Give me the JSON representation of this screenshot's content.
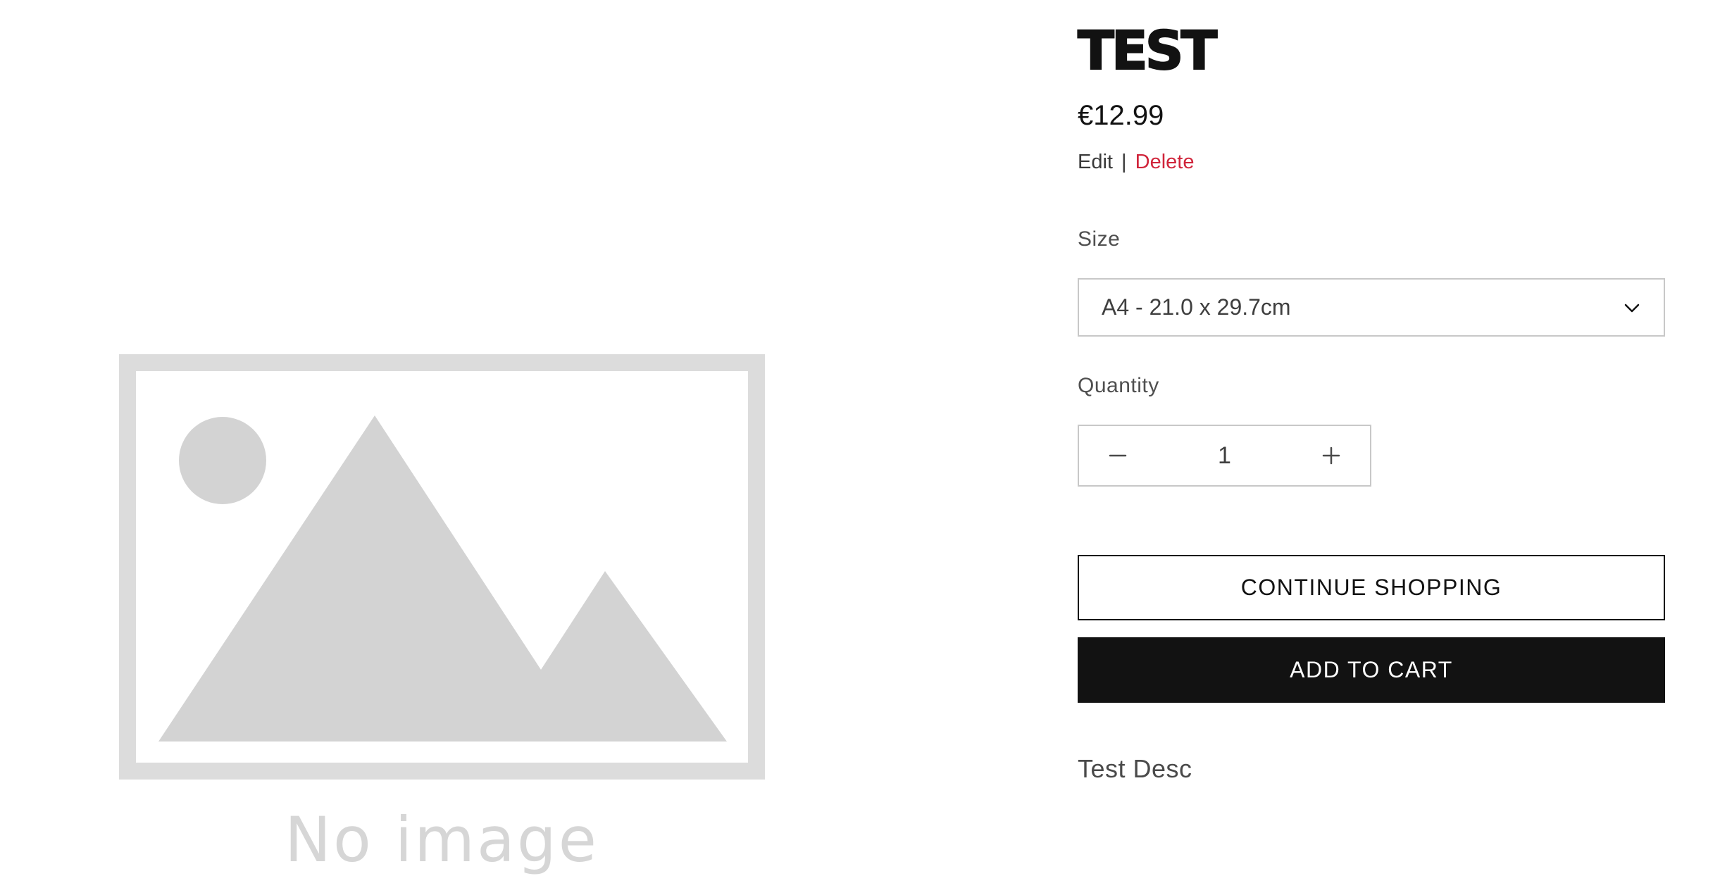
{
  "media": {
    "placeholder_icon": "image-placeholder-icon",
    "no_image_text": "No image"
  },
  "product": {
    "title": "TEST",
    "price": "€12.99",
    "admin": {
      "edit_label": "Edit",
      "separator": "|",
      "delete_label": "Delete"
    },
    "size": {
      "label": "Size",
      "selected": "A4 - 21.0 x 29.7cm",
      "icon": "chevron-down-icon"
    },
    "quantity": {
      "label": "Quantity",
      "value": "1",
      "decrease_icon": "minus-icon",
      "increase_icon": "plus-icon"
    },
    "buttons": {
      "continue_label": "CONTINUE SHOPPING",
      "add_to_cart_label": "ADD TO CART"
    },
    "description": "Test Desc"
  },
  "colors": {
    "text": "#121212",
    "delete": "#d0243a",
    "border": "#c8c8c8",
    "placeholder": "#d3d3d3"
  }
}
